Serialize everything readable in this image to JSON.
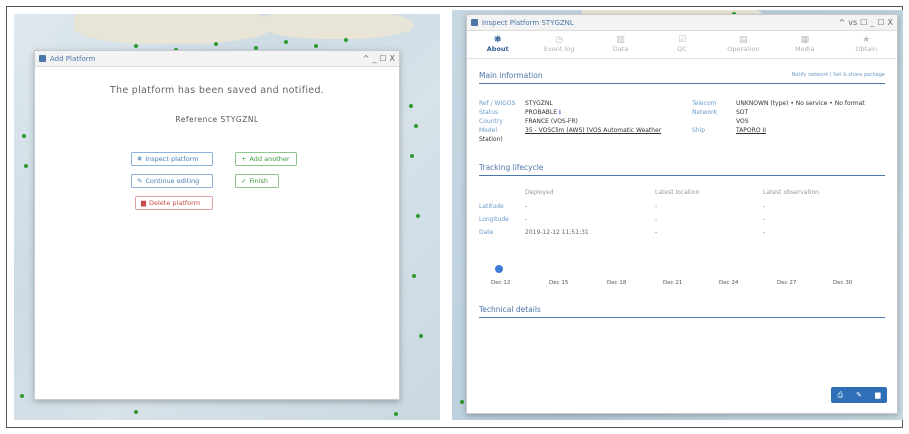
{
  "add_window": {
    "title": "Add Platform",
    "controls": [
      "^",
      "_",
      "☐",
      "X"
    ],
    "saved_message": "The platform has been saved and notified.",
    "reference_label": "Reference STYGZNL",
    "buttons": {
      "inspect": "Inspect platform",
      "add_another": "Add another",
      "continue": "Continue editing",
      "finish": "Finish",
      "delete": "Delete platform"
    }
  },
  "inspect_window": {
    "title": "Inspect Platform STYGZNL",
    "controls": [
      "^",
      "vs",
      "☐",
      "_",
      "☐",
      "X"
    ],
    "tabs": [
      {
        "label": "About",
        "icon": "binoculars-icon"
      },
      {
        "label": "Event log",
        "icon": "clock-icon"
      },
      {
        "label": "Data",
        "icon": "bar-chart-icon"
      },
      {
        "label": "QC",
        "icon": "check-circle-icon"
      },
      {
        "label": "Operation",
        "icon": "clipboard-icon"
      },
      {
        "label": "Media",
        "icon": "image-icon"
      },
      {
        "label": "Obtain",
        "icon": "star-icon"
      }
    ],
    "main_info": {
      "heading": "Main information",
      "links": "Notify network  |  Set & share package",
      "rows_left": [
        {
          "k": "Ref / WIGOS",
          "v": "STYGZNL"
        },
        {
          "k": "Status",
          "v": "PROBABLE"
        },
        {
          "k": "Country",
          "v": "FRANCE (VOS-FR)"
        },
        {
          "k": "Model",
          "v": "35 - VOSClim (AWS) (VOS Automatic Weather"
        },
        {
          "k": "",
          "v": "Station)"
        }
      ],
      "rows_right": [
        {
          "k": "Telecom",
          "v": "UNKNOWN (type) • No service • No format"
        },
        {
          "k": "Network",
          "v": "SOT"
        },
        {
          "k": "",
          "v": "VOS"
        },
        {
          "k": "Ship",
          "v": "TAPORO II"
        }
      ]
    },
    "tracking": {
      "heading": "Tracking lifecycle",
      "columns": [
        "Deployed",
        "Latest location",
        "Latest observation"
      ],
      "rows": [
        {
          "k": "Latitude",
          "c1": "-",
          "c2": "-",
          "c3": "-"
        },
        {
          "k": "Longitude",
          "c1": "-",
          "c2": "-",
          "c3": "-"
        },
        {
          "k": "Date",
          "c1": "2019-12-12 11:51:31",
          "c2": "-",
          "c3": "-"
        }
      ],
      "timeline": [
        "Dec 12",
        "Dec 15",
        "Dec 18",
        "Dec 21",
        "Dec 24",
        "Dec 27",
        "Dec 30"
      ]
    },
    "technical": {
      "heading": "Technical details"
    },
    "footer_icons": [
      "print-icon",
      "edit-icon",
      "delete-icon"
    ],
    "colors": {
      "accent": "#4a76a8",
      "primary_button": "#2f6fb7",
      "map_dot": "#2e9b2e"
    }
  }
}
